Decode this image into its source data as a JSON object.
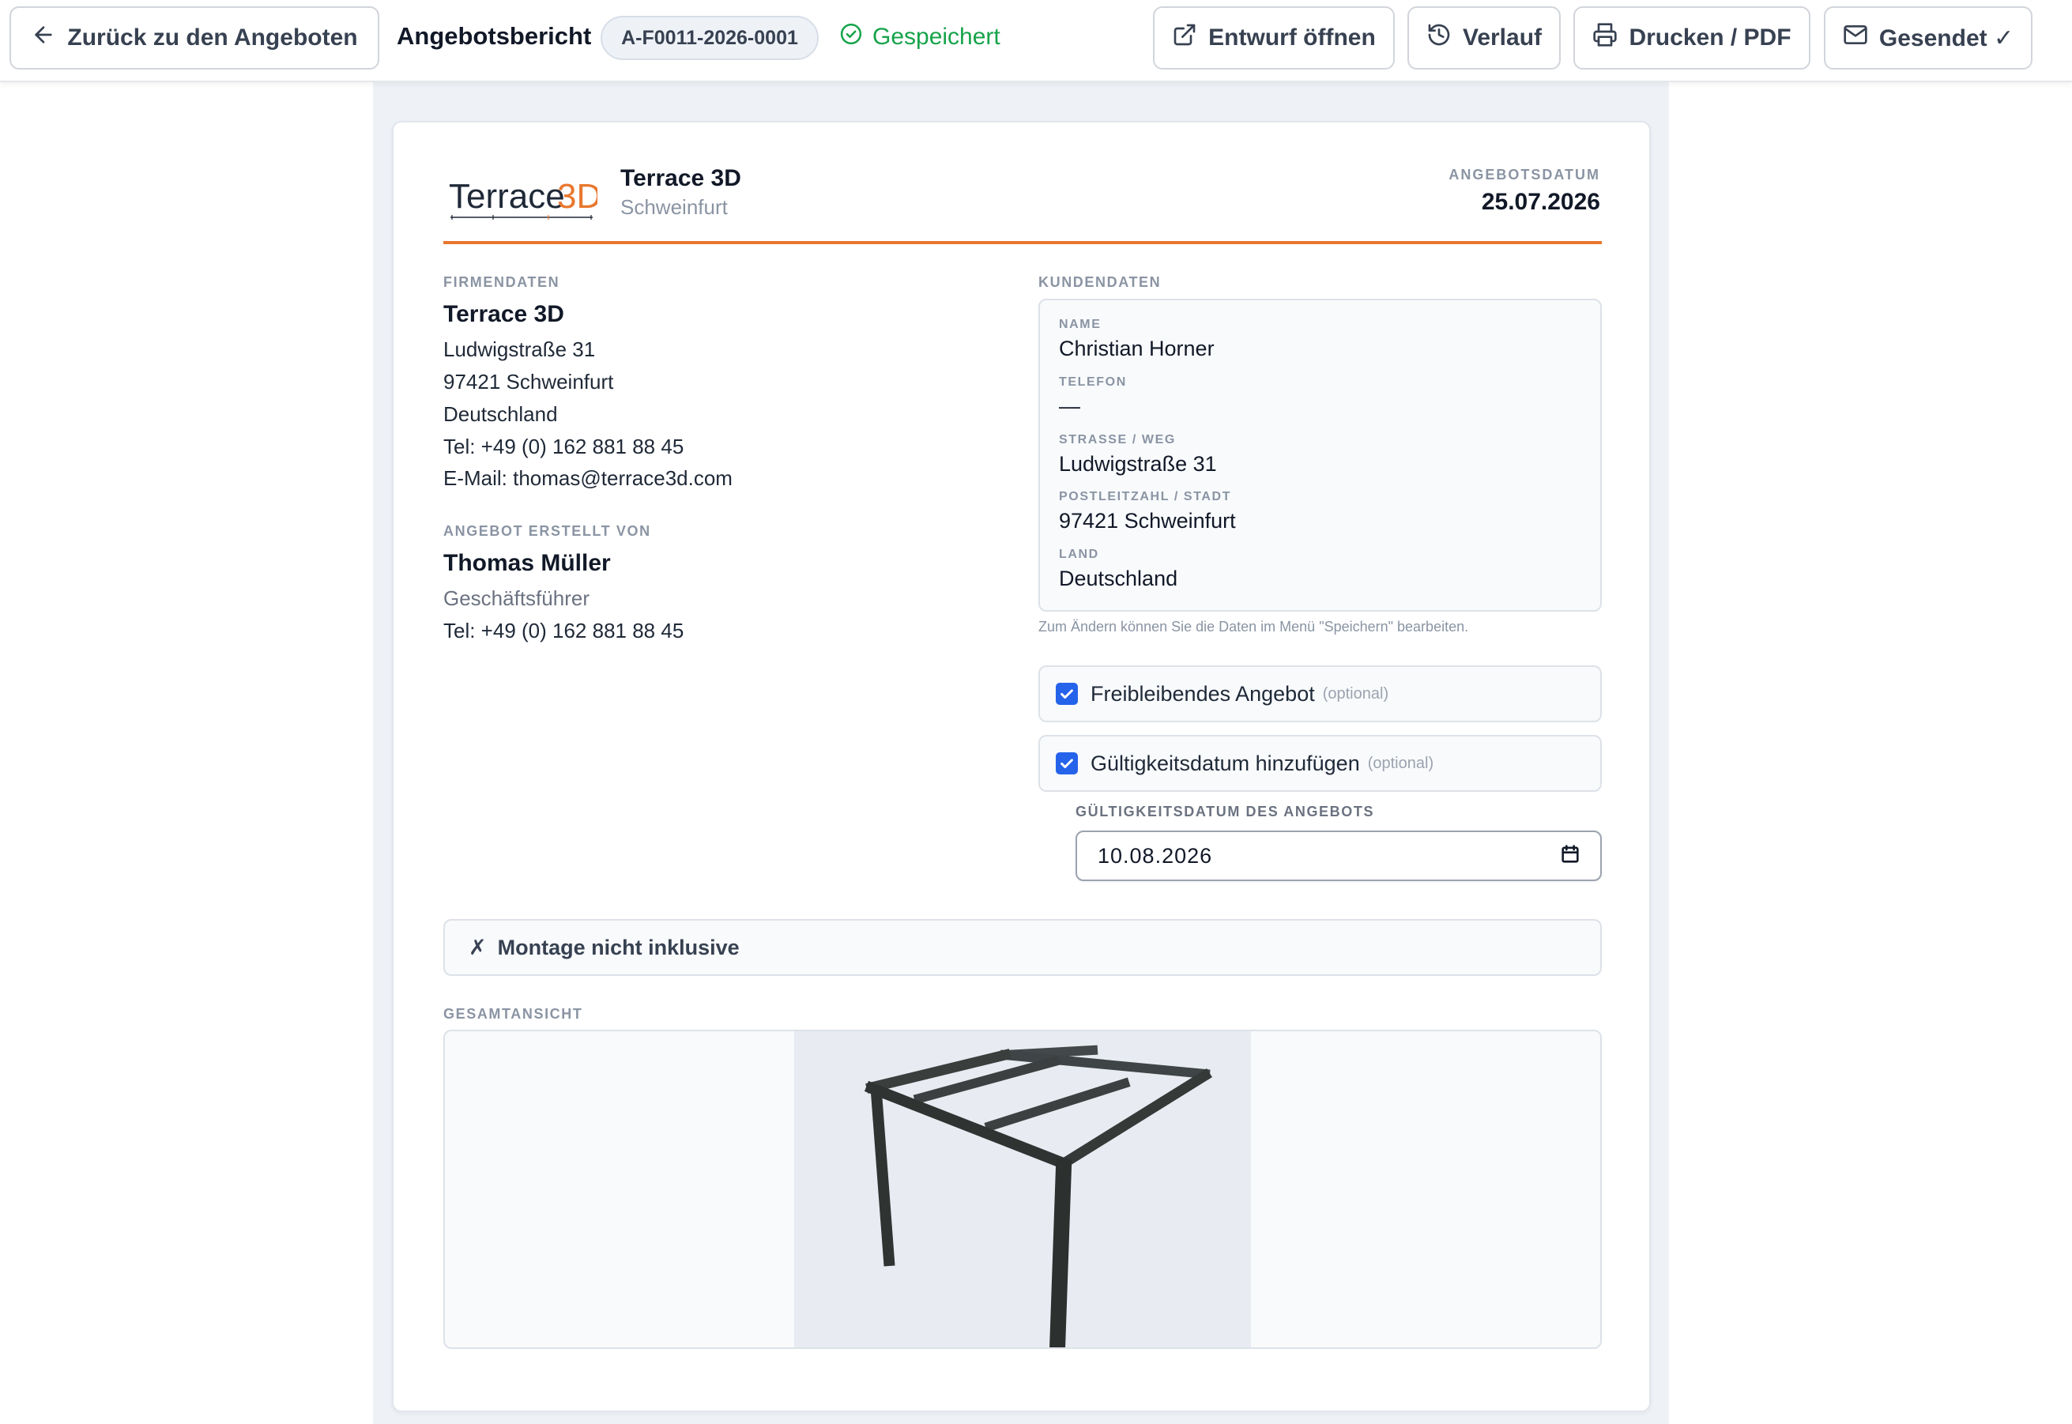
{
  "toolbar": {
    "back_label": "Zurück zu den Angeboten",
    "report_title": "Angebotsbericht",
    "doc_number": "A-F0011-2026-0001",
    "saved_status": "Gespeichert",
    "draft_label": "Entwurf öffnen",
    "history_label": "Verlauf",
    "print_label": "Drucken / PDF",
    "sent_label": "Gesendet ✓"
  },
  "header": {
    "logo_text_main": "Terrace",
    "logo_text_accent": "3D",
    "company_name": "Terrace 3D",
    "company_city": "Schweinfurt",
    "date_label": "ANGEBOTSDATUM",
    "date_value": "25.07.2026"
  },
  "company": {
    "section_label": "FIRMENDATEN",
    "name": "Terrace 3D",
    "street": "Ludwigstraße 31",
    "city": "97421 Schweinfurt",
    "country": "Deutschland",
    "phone": "Tel: +49 (0) 162 881 88 45",
    "email": "E-Mail: thomas@terrace3d.com"
  },
  "creator": {
    "section_label": "ANGEBOT ERSTELLT VON",
    "name": "Thomas Müller",
    "role": "Geschäftsführer",
    "phone": "Tel: +49 (0) 162 881 88 45"
  },
  "customer": {
    "section_label": "KUNDENDATEN",
    "name_label": "NAME",
    "name": "Christian Horner",
    "phone_label": "TELEFON",
    "phone": "—",
    "street_label": "STRASSE / WEG",
    "street": "Ludwigstraße 31",
    "zip_label": "POSTLEITZAHL / STADT",
    "zip_city": "97421 Schweinfurt",
    "country_label": "LAND",
    "country": "Deutschland",
    "hint": "Zum Ändern können Sie die Daten im Menü \"Speichern\" bearbeiten."
  },
  "options": {
    "freibleibend_label": "Freibleibendes Angebot",
    "freibleibend_checked": true,
    "validity_label": "Gültigkeitsdatum hinzufügen",
    "validity_checked": true,
    "optional_tag": "(optional)",
    "validity_date_label": "GÜLTIGKEITSDATUM DES ANGEBOTS",
    "validity_date": "10.08.2026"
  },
  "montage": {
    "mark": "✗",
    "text": "Montage nicht inklusive"
  },
  "overview": {
    "label": "GESAMTANSICHT"
  },
  "colors": {
    "accent_orange": "#e8772e",
    "checkbox_blue": "#2563eb",
    "saved_green": "#16a34a",
    "frame_dark": "#3a3e3d"
  },
  "icons": [
    "arrow-left-icon",
    "check-circle-icon",
    "external-link-icon",
    "history-icon",
    "printer-icon",
    "mail-icon",
    "calendar-icon",
    "checkmark-icon"
  ]
}
